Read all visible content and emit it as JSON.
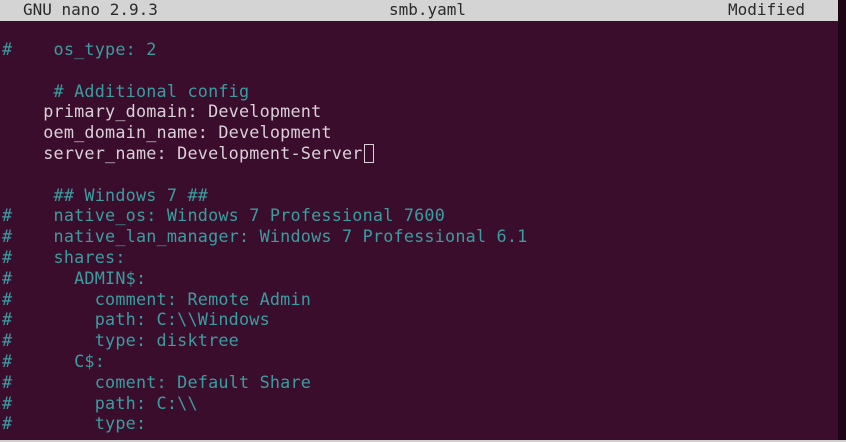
{
  "titlebar": {
    "app": "GNU nano 2.9.3",
    "filename": "smb.yaml",
    "status": "Modified"
  },
  "colors": {
    "background": "#3b0d2c",
    "comment": "#3a9da0",
    "text": "#d9d0d8",
    "titlebar": "#d4d4d4"
  },
  "lines": [
    {
      "text": "#    os_type: 2",
      "style": "comment"
    },
    {
      "text": "",
      "style": "normal"
    },
    {
      "text": "     # Additional config",
      "style": "comment"
    },
    {
      "text": "    primary_domain: Development",
      "style": "normal"
    },
    {
      "text": "    oem_domain_name: Development",
      "style": "normal"
    },
    {
      "text": "    server_name: Development-Server",
      "style": "normal",
      "cursor": true
    },
    {
      "text": "",
      "style": "normal"
    },
    {
      "text": "     ## Windows 7 ##",
      "style": "comment"
    },
    {
      "text": "#    native_os: Windows 7 Professional 7600",
      "style": "comment"
    },
    {
      "text": "#    native_lan_manager: Windows 7 Professional 6.1",
      "style": "comment"
    },
    {
      "text": "#    shares:",
      "style": "comment"
    },
    {
      "text": "#      ADMIN$:",
      "style": "comment"
    },
    {
      "text": "#        comment: Remote Admin",
      "style": "comment"
    },
    {
      "text": "#        path: C:\\\\Windows",
      "style": "comment"
    },
    {
      "text": "#        type: disktree",
      "style": "comment"
    },
    {
      "text": "#      C$:",
      "style": "comment"
    },
    {
      "text": "#        coment: Default Share",
      "style": "comment"
    },
    {
      "text": "#        path: C:\\\\",
      "style": "comment"
    },
    {
      "text": "#        type:",
      "style": "comment"
    }
  ]
}
